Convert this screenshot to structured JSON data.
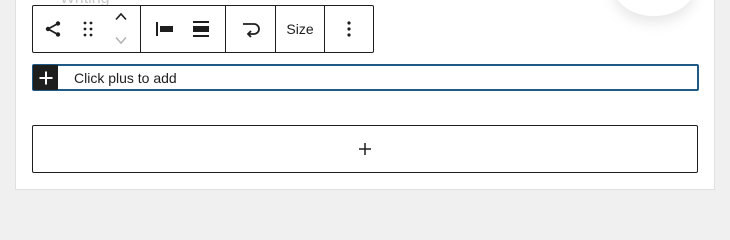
{
  "behind": {
    "text": "Writing"
  },
  "toolbar": {
    "parent_icon": "share-icon",
    "drag_icon": "drag-handle-icon",
    "move_up_icon": "chevron-up-icon",
    "move_down_icon": "chevron-down-icon",
    "justify_left_icon": "justify-left-icon",
    "vertical_align_icon": "align-center-icon",
    "wrap_icon": "wrap-icon",
    "size_label": "Size",
    "more_icon": "more-vertical-icon"
  },
  "appender_row": {
    "icon": "plus-icon",
    "text": "Click plus to add"
  },
  "block_appender": {
    "icon": "plus-icon"
  },
  "colors": {
    "focus_border": "#1f5a87",
    "dark": "#1e1e1e",
    "canvas_bg": "#ffffff",
    "page_bg": "#f0f0f1"
  }
}
